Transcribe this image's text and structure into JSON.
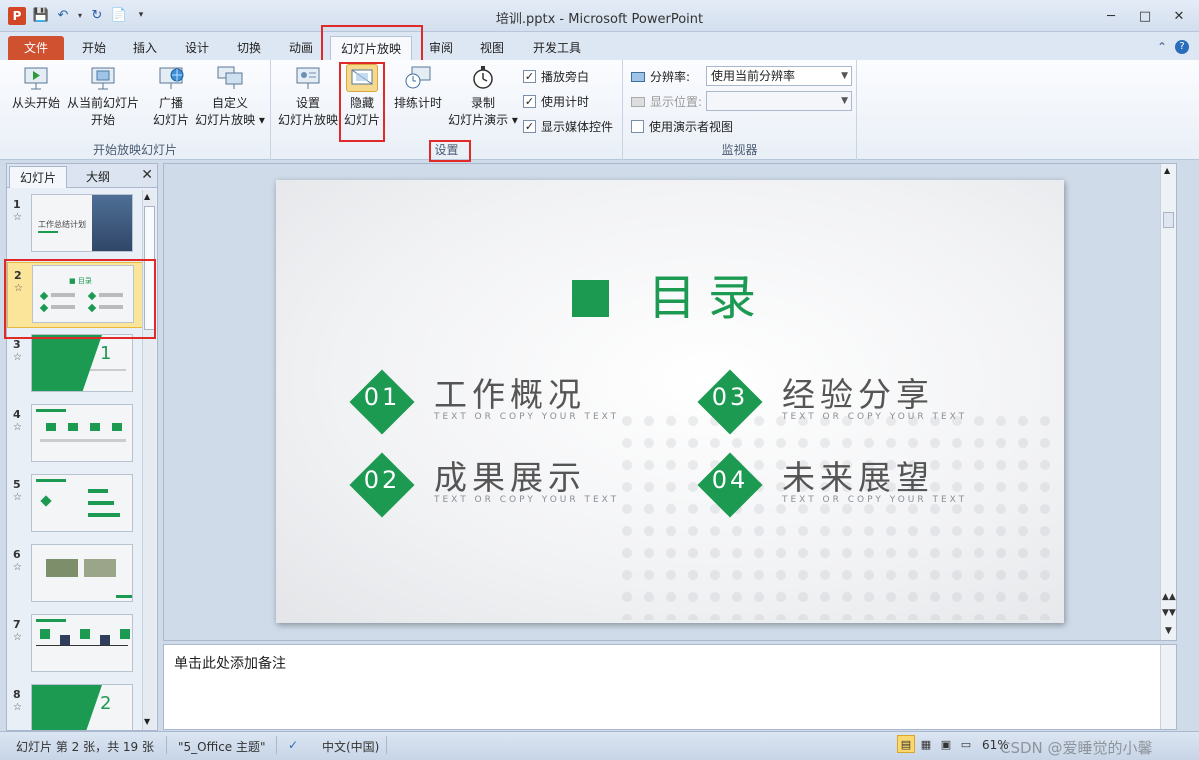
{
  "window": {
    "app_icon_letter": "P",
    "title": "培训.pptx - Microsoft PowerPoint"
  },
  "tabs": {
    "file": "文件",
    "items": [
      "开始",
      "插入",
      "设计",
      "切换",
      "动画",
      "幻灯片放映",
      "审阅",
      "视图",
      "开发工具"
    ],
    "active": "幻灯片放映"
  },
  "ribbon": {
    "group_start": {
      "label": "开始放映幻灯片",
      "from_beginning": "从头开始",
      "from_current_1": "从当前幻灯片",
      "from_current_2": "开始",
      "broadcast_1": "广播",
      "broadcast_2": "幻灯片",
      "custom_1": "自定义",
      "custom_2": "幻灯片放映 ▾"
    },
    "group_setup": {
      "label": "设置",
      "setup_1": "设置",
      "setup_2": "幻灯片放映",
      "hide_1": "隐藏",
      "hide_2": "幻灯片",
      "rehearse": "排练计时",
      "record_1": "录制",
      "record_2": "幻灯片演示 ▾",
      "checkbox_narration": "播放旁白",
      "checkbox_timing": "使用计时",
      "checkbox_media": "显示媒体控件"
    },
    "group_monitors": {
      "label": "监视器",
      "resolution_label": "分辨率:",
      "resolution_value": "使用当前分辨率",
      "show_on_label": "显示位置:",
      "show_on_value": "",
      "presenter_view": "使用演示者视图"
    }
  },
  "left_panel": {
    "tab_slides": "幻灯片",
    "tab_outline": "大纲",
    "slide_numbers": [
      "1",
      "2",
      "3",
      "4",
      "5",
      "6",
      "7",
      "8"
    ],
    "selected": "2",
    "thumb1_text": "工作总结计划",
    "thumb2_title": "■ 目录",
    "thumb3_number": "1",
    "thumb8_number": "2"
  },
  "slide": {
    "title": "目录",
    "items": [
      {
        "num": "01",
        "title": "工作概况",
        "sub": "TEXT OR COPY YOUR TEXT"
      },
      {
        "num": "02",
        "title": "成果展示",
        "sub": "TEXT OR COPY YOUR TEXT"
      },
      {
        "num": "03",
        "title": "经验分享",
        "sub": "TEXT OR COPY YOUR TEXT"
      },
      {
        "num": "04",
        "title": "未来展望",
        "sub": "TEXT OR COPY YOUR TEXT"
      }
    ],
    "accent_color": "#1d9a52"
  },
  "notes": {
    "placeholder": "单击此处添加备注"
  },
  "status": {
    "slide_info": "幻灯片 第 2 张，共 19 张",
    "theme": "\"5_Office 主题\"",
    "language": "中文(中国)",
    "zoom": "61%",
    "watermark": "CSDN @爱睡觉的小馨"
  }
}
